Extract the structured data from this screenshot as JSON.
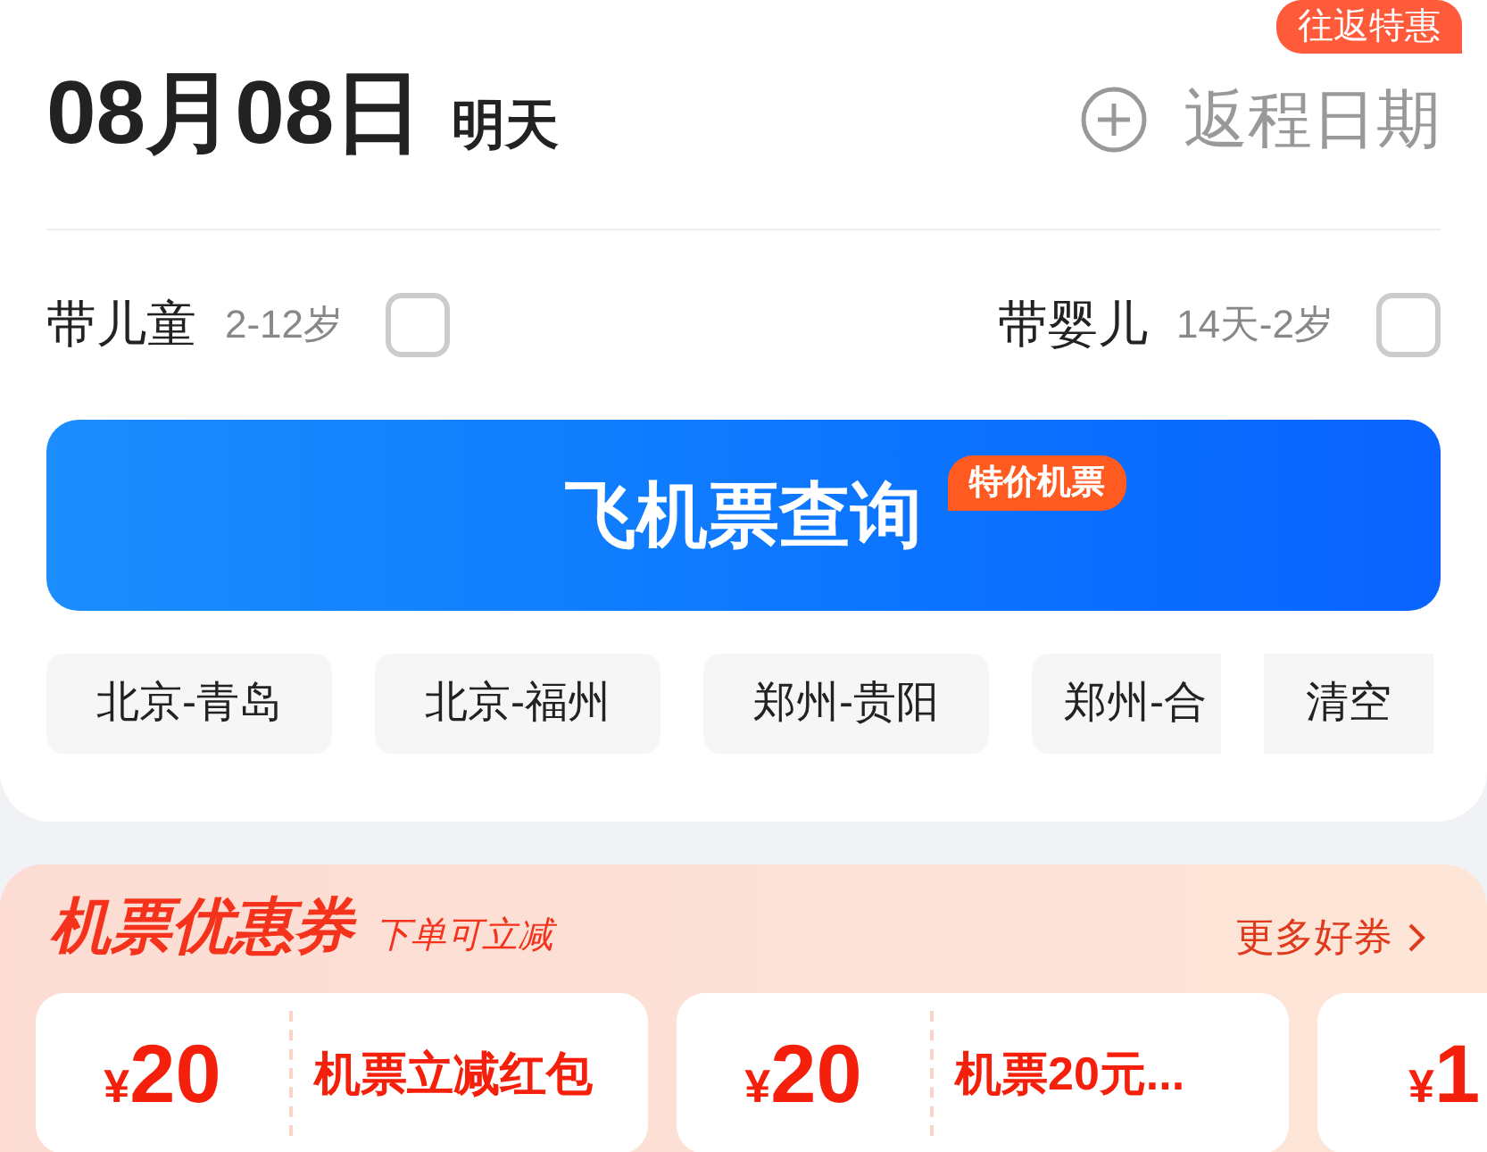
{
  "trip": {
    "date": "08月08日",
    "day_label": "明天",
    "return_label": "返程日期",
    "return_badge": "往返特惠"
  },
  "passengers": [
    {
      "label": "带儿童",
      "age": "2-12岁",
      "checked": false
    },
    {
      "label": "带婴儿",
      "age": "14天-2岁",
      "checked": false
    }
  ],
  "search_button": {
    "label": "飞机票查询",
    "badge": "特价机票"
  },
  "history": [
    "北京-青岛",
    "北京-福州",
    "郑州-贵阳",
    "郑州-合"
  ],
  "clear_label": "清空",
  "coupons_panel": {
    "title": "机票优惠券",
    "subtitle": "下单可立减",
    "more_link": "更多好券",
    "coupons": [
      {
        "amount": "20",
        "currency": "¥",
        "title": "机票立减红包"
      },
      {
        "amount": "20",
        "currency": "¥",
        "title": "机票20元..."
      },
      {
        "amount": "1",
        "currency": "¥"
      }
    ]
  }
}
